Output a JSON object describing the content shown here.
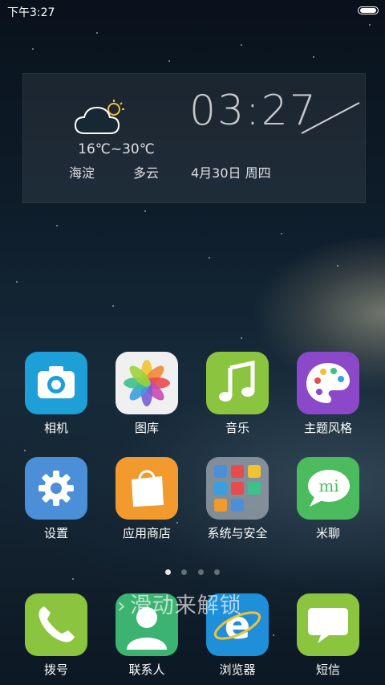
{
  "status": {
    "time": "下午3:27"
  },
  "widget": {
    "temperature": "16℃~30℃",
    "city": "海淀",
    "condition": "多云",
    "clock": "03:27",
    "date": "4月30日 周四"
  },
  "apps": [
    {
      "label": "相机",
      "icon": "camera-icon",
      "color": "#1e9fd8"
    },
    {
      "label": "图库",
      "icon": "gallery-icon",
      "color": "#f2f2f2"
    },
    {
      "label": "音乐",
      "icon": "music-icon",
      "color": "#8bc53f"
    },
    {
      "label": "主题风格",
      "icon": "palette-icon",
      "color": "#8b48c9"
    },
    {
      "label": "设置",
      "icon": "gear-icon",
      "color": "#4a8fd8"
    },
    {
      "label": "应用商店",
      "icon": "shopping-bag-icon",
      "color": "#f29a2e"
    },
    {
      "label": "系统与安全",
      "icon": "folder-icon",
      "color": "#9aa4ad"
    },
    {
      "label": "米聊",
      "icon": "chat-icon",
      "color": "#4cbb5e"
    }
  ],
  "pager": {
    "pages": 4,
    "current": 0
  },
  "unlock_hint": "滑动来解锁",
  "dock": [
    {
      "label": "拨号",
      "icon": "phone-icon",
      "color": "#8bc53f"
    },
    {
      "label": "联系人",
      "icon": "contacts-icon",
      "color": "#3cb371"
    },
    {
      "label": "浏览器",
      "icon": "browser-icon",
      "color": "#1e8fd8"
    },
    {
      "label": "短信",
      "icon": "message-icon",
      "color": "#8bc53f"
    }
  ]
}
